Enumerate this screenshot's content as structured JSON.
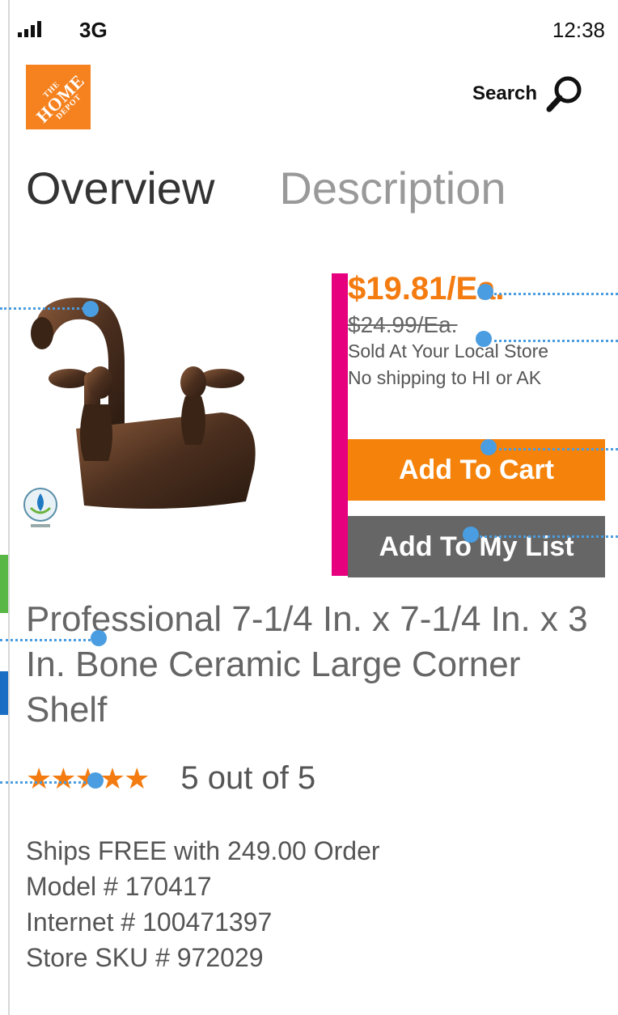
{
  "status_bar": {
    "network": "3G",
    "time": "12:38"
  },
  "header": {
    "logo": {
      "line1": "THE",
      "line2": "HOME",
      "line3": "DEPOT",
      "color": "#f5821f"
    },
    "search_label": "Search"
  },
  "tabs": [
    {
      "label": "Overview",
      "active": true
    },
    {
      "label": "Description",
      "active": false
    }
  ],
  "pricing": {
    "sale_price": "$19.81/Ea.",
    "original_price": "$24.99/Ea.",
    "note_line1": "Sold At Your Local Store",
    "note_line2": "No shipping to HI or AK"
  },
  "actions": {
    "add_to_cart": "Add To Cart",
    "add_to_list": "Add To My List"
  },
  "product": {
    "title": "Professional 7-1/4 In. x 7-1/4 In. x 3 In. Bone Ceramic Large Corner Shelf",
    "rating_stars": "★★★★★",
    "rating_value": 5,
    "rating_text": "5 out of 5",
    "shipping": "Ships FREE with 249.00 Order",
    "model": "Model # 170417",
    "internet": "Internet # 100471397",
    "store_sku": "Store SKU # 972029"
  },
  "colors": {
    "accent_orange": "#f47b0f",
    "accent_magenta": "#e6007e",
    "hotspot_blue": "#4a9de0"
  }
}
